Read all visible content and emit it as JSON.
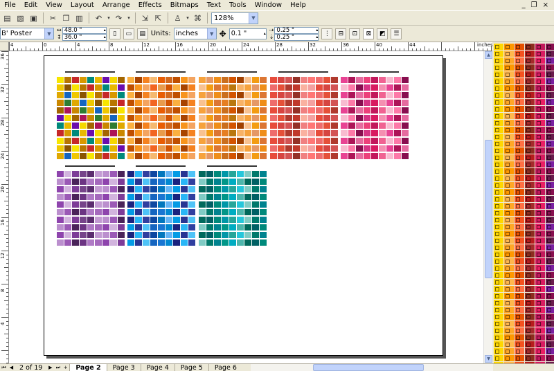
{
  "menu": [
    "File",
    "Edit",
    "View",
    "Layout",
    "Arrange",
    "Effects",
    "Bitmaps",
    "Text",
    "Tools",
    "Window",
    "Help"
  ],
  "window_controls": {
    "minimize": "_",
    "restore": "❐",
    "close": "×"
  },
  "toolbar": {
    "zoom_value": "128%"
  },
  "property_bar": {
    "paper_type": "B' Poster",
    "width": "48.0 \"",
    "height": "36.0 \"",
    "units_label": "Units:",
    "units_value": "inches",
    "nudge": "0.1 \"",
    "dup_x": "0.25 \"",
    "dup_y": "0.25 \""
  },
  "ruler": {
    "unit": "inches",
    "top_labels": [
      "4",
      "0",
      "4",
      "8",
      "12",
      "16",
      "20",
      "24",
      "28",
      "32",
      "36",
      "40",
      "44"
    ],
    "left_labels": [
      "36",
      "32",
      "28",
      "24",
      "20",
      "16",
      "12",
      "8",
      "4"
    ]
  },
  "pager": {
    "count": "2 of 19",
    "tabs": [
      "Page 2",
      "Page 3",
      "Page 4",
      "Page 5",
      "Page 6"
    ],
    "active_tab": "Page 2"
  },
  "colors": {
    "ui_bg": "#ece9d8",
    "scroll_accent": "#c1d3fb"
  },
  "icons": [
    "new-icon",
    "open-icon",
    "save-icon",
    "print-icon",
    "cut-icon",
    "copy-icon",
    "paste-icon",
    "undo-icon",
    "redo-icon",
    "import-icon",
    "export-icon",
    "launcher-icon",
    "zoom-levels"
  ]
}
